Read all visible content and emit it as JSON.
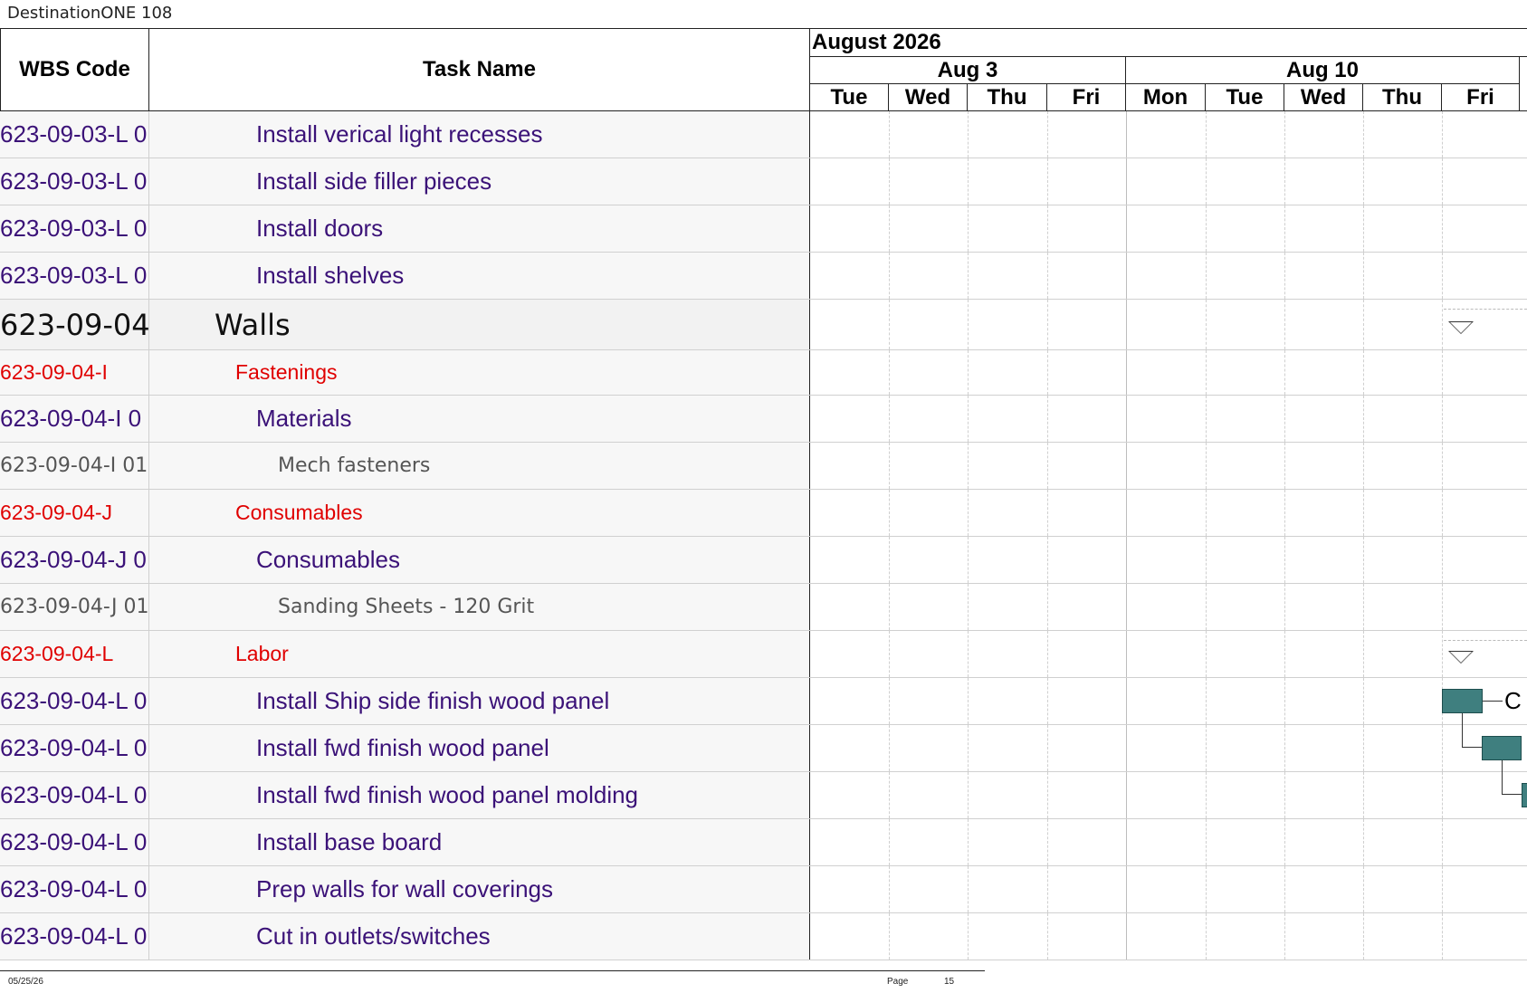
{
  "document": {
    "title": "DestinationONE 108"
  },
  "columns": {
    "wbs_header": "WBS Code",
    "task_header": "Task Name"
  },
  "timeline": {
    "month": "August 2026",
    "weeks": [
      "Aug 3",
      "Aug 10"
    ],
    "days": [
      "Tue",
      "Wed",
      "Thu",
      "Fri",
      "Mon",
      "Tue",
      "Wed",
      "Thu",
      "Fri"
    ]
  },
  "rows": [
    {
      "wbs": "623-09-03-L 0",
      "task": "Install verical light recesses",
      "level": "detail"
    },
    {
      "wbs": "623-09-03-L 0",
      "task": "Install side filler pieces",
      "level": "detail"
    },
    {
      "wbs": "623-09-03-L 0",
      "task": "Install doors",
      "level": "detail"
    },
    {
      "wbs": "623-09-03-L 0",
      "task": "Install shelves",
      "level": "detail"
    },
    {
      "wbs": "623-09-04",
      "task": "Walls",
      "level": "section"
    },
    {
      "wbs": "623-09-04-I",
      "task": "Fastenings",
      "level": "group"
    },
    {
      "wbs": "623-09-04-I 0",
      "task": "Materials",
      "level": "sub"
    },
    {
      "wbs": "623-09-04-I 01",
      "task": "Mech fasteners",
      "level": "item"
    },
    {
      "wbs": "623-09-04-J",
      "task": "Consumables",
      "level": "group"
    },
    {
      "wbs": "623-09-04-J 0",
      "task": "Consumables",
      "level": "sub"
    },
    {
      "wbs": "623-09-04-J 01",
      "task": "Sanding Sheets - 120 Grit",
      "level": "item"
    },
    {
      "wbs": "623-09-04-L",
      "task": "Labor",
      "level": "group"
    },
    {
      "wbs": "623-09-04-L 0",
      "task": "Install Ship side finish wood panel",
      "level": "detail"
    },
    {
      "wbs": "623-09-04-L 0",
      "task": "Install fwd finish wood panel",
      "level": "detail"
    },
    {
      "wbs": "623-09-04-L 0",
      "task": "Install fwd finish wood panel molding",
      "level": "detail"
    },
    {
      "wbs": "623-09-04-L 0",
      "task": "Install base board",
      "level": "detail"
    },
    {
      "wbs": "623-09-04-L 0",
      "task": "Prep walls for wall coverings",
      "level": "detail"
    },
    {
      "wbs": "623-09-04-L 0",
      "task": "Cut in outlets/switches",
      "level": "detail"
    }
  ],
  "bar_label": "C",
  "footer": {
    "date": "05/25/26",
    "page_label": "Page",
    "page_number": "15"
  },
  "colors": {
    "bar_fill": "#3f7f7f",
    "detail_text": "#3b1278",
    "group_text": "#e00000",
    "item_text": "#555555"
  }
}
